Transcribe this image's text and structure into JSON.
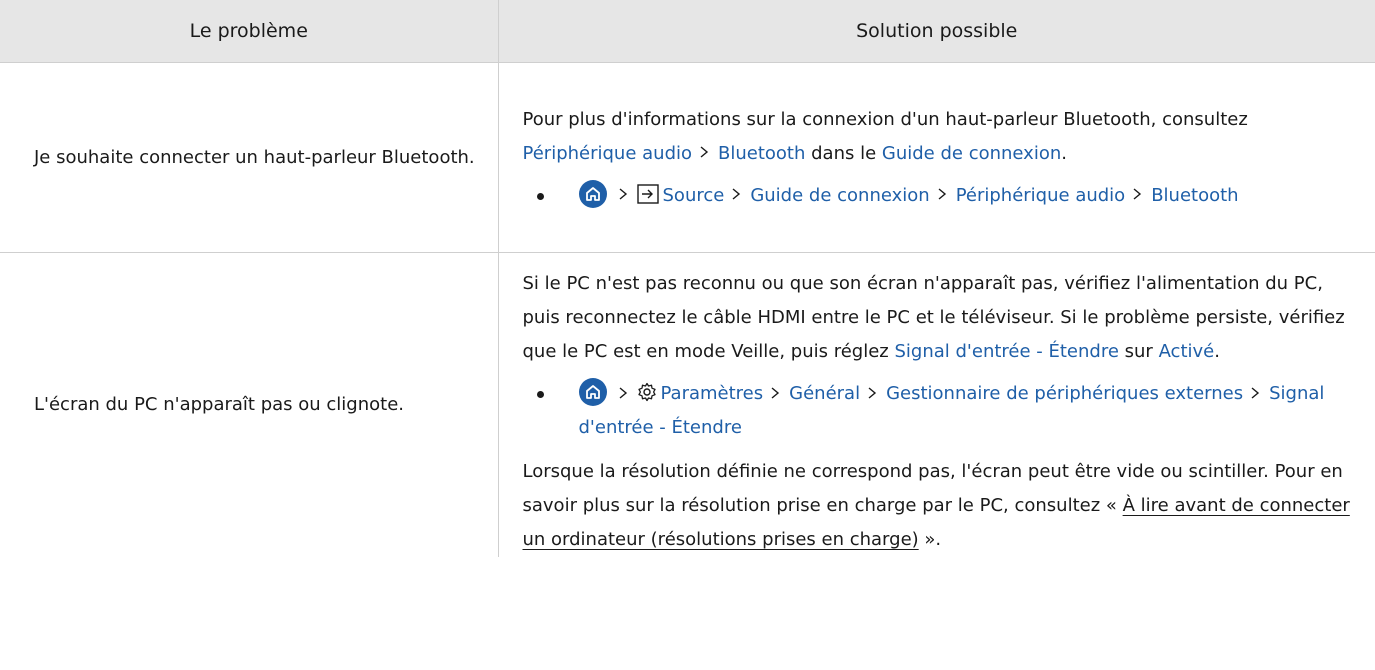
{
  "header": {
    "col_problem": "Le problème",
    "col_solution": "Solution possible"
  },
  "separator_icon": "chevron-right-icon",
  "accent_color": "#1f5fa8",
  "rows": [
    {
      "problem": "Je souhaite connecter un haut-parleur Bluetooth.",
      "intro": {
        "t1": "Pour plus d'informations sur la connexion d'un haut-parleur Bluetooth, consultez ",
        "l1": "Périphérique audio",
        "l2": "Bluetooth",
        "t2": " dans le ",
        "l3": "Guide de connexion",
        "t3": "."
      },
      "path": {
        "home_icon": "home-icon",
        "source_icon": "source-input-icon",
        "items": [
          "Source",
          "Guide de connexion",
          "Périphérique audio",
          "Bluetooth"
        ]
      }
    },
    {
      "problem": "L'écran du PC n'apparaît pas ou clignote.",
      "intro": {
        "t1": "Si le PC n'est pas reconnu ou que son écran n'apparaît pas, vérifiez l'alimentation du PC, puis reconnectez le câble HDMI entre le PC et le téléviseur. Si le problème persiste, vérifiez que le PC est en mode Veille, puis réglez ",
        "l1": "Signal d'entrée - Étendre",
        "t2": " sur ",
        "l2": "Activé",
        "t3": "."
      },
      "path": {
        "home_icon": "home-icon",
        "settings_icon": "gear-icon",
        "items": [
          "Paramètres",
          "Général",
          "Gestionnaire de périphériques externes",
          "Signal d'entrée - Étendre"
        ]
      },
      "outro": {
        "t1": "Lorsque la résolution définie ne correspond pas, l'écran peut être vide ou scintiller. Pour en savoir plus sur la résolution prise en charge par le PC, consultez « ",
        "link": "À lire avant de connecter un ordinateur (résolutions prises en charge)",
        "t2": " »."
      }
    }
  ]
}
